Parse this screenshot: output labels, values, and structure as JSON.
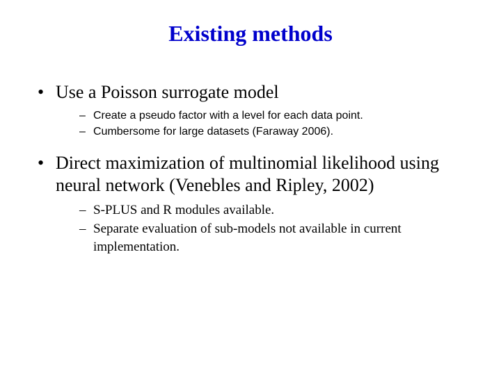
{
  "title": "Existing methods",
  "bullets": [
    {
      "text": "Use a Poisson surrogate model",
      "sub": [
        "Create a pseudo factor with a level for each data point.",
        "Cumbersome for large datasets (Faraway 2006)."
      ],
      "subStyle": "sans"
    },
    {
      "text": "Direct maximization of multinomial likelihood using neural network (Venebles and Ripley, 2002)",
      "sub": [
        "S-PLUS and R modules available.",
        "Separate evaluation of sub-models not available in current implementation."
      ],
      "subStyle": "serif"
    }
  ]
}
